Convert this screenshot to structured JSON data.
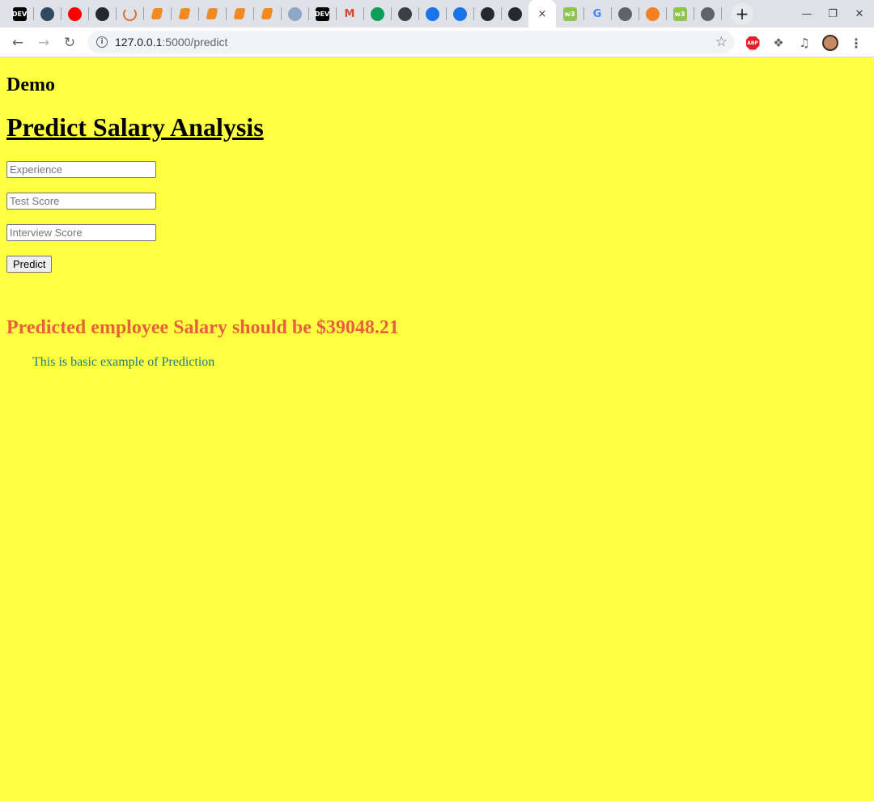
{
  "browser": {
    "url_host": "127.0.0.1",
    "url_path": ":5000/predict",
    "tabs": [
      {
        "icon": "dev-icon",
        "label": "DEV",
        "color": "#000000"
      },
      {
        "icon": "circle-app-icon",
        "label": "",
        "color": "#2f4a5f"
      },
      {
        "icon": "youtube-icon",
        "label": "",
        "color": "#ff0000"
      },
      {
        "icon": "github-icon",
        "label": "",
        "color": "#24292e"
      },
      {
        "icon": "loader-icon",
        "label": "",
        "color": "#e96b2e"
      },
      {
        "icon": "book-icon",
        "label": "",
        "color": "#f08a24"
      },
      {
        "icon": "book-icon",
        "label": "",
        "color": "#f08a24"
      },
      {
        "icon": "book-icon",
        "label": "",
        "color": "#f08a24"
      },
      {
        "icon": "book-icon",
        "label": "",
        "color": "#f08a24"
      },
      {
        "icon": "book-icon",
        "label": "",
        "color": "#f08a24"
      },
      {
        "icon": "cloud-bot-icon",
        "label": "",
        "color": "#8fa7c7"
      },
      {
        "icon": "dev-icon",
        "label": "DEV",
        "color": "#000000"
      },
      {
        "icon": "gmail-icon",
        "label": "M",
        "color": "#ea4335"
      },
      {
        "icon": "sheets-icon",
        "label": "",
        "color": "#0f9d58"
      },
      {
        "icon": "diamond-icon",
        "label": "",
        "color": "#3c4043"
      },
      {
        "icon": "refresh-app-icon",
        "label": "",
        "color": "#1a73e8"
      },
      {
        "icon": "refresh-app-icon",
        "label": "",
        "color": "#1a73e8"
      },
      {
        "icon": "github-icon",
        "label": "",
        "color": "#24292e"
      },
      {
        "icon": "github-icon",
        "label": "",
        "color": "#24292e"
      },
      {
        "icon": "close-icon",
        "label": "×",
        "color": "#3c4043",
        "active": true
      },
      {
        "icon": "w3-icon",
        "label": "w3",
        "color": "#8ec44f"
      },
      {
        "icon": "google-icon",
        "label": "G",
        "color": "#4285f4"
      },
      {
        "icon": "globe-icon",
        "label": "",
        "color": "#5f6368"
      },
      {
        "icon": "stackoverflow-icon",
        "label": "",
        "color": "#f48024"
      },
      {
        "icon": "w3-icon",
        "label": "w3",
        "color": "#8ec44f"
      },
      {
        "icon": "speaker-icon",
        "label": "",
        "color": "#5f6368"
      }
    ]
  },
  "page": {
    "background": "#ffff41",
    "demo_title": "Demo",
    "main_title": "Predict Salary Analysis",
    "inputs": {
      "experience_placeholder": "Experience",
      "test_score_placeholder": "Test Score",
      "interview_score_placeholder": "Interview Score"
    },
    "predict_button": "Predict",
    "result_text": "Predicted employee Salary should be $39048.21",
    "result_color": "#e8603c",
    "note_text": "This is basic example of Prediction",
    "note_color": "#1f7a8c"
  }
}
